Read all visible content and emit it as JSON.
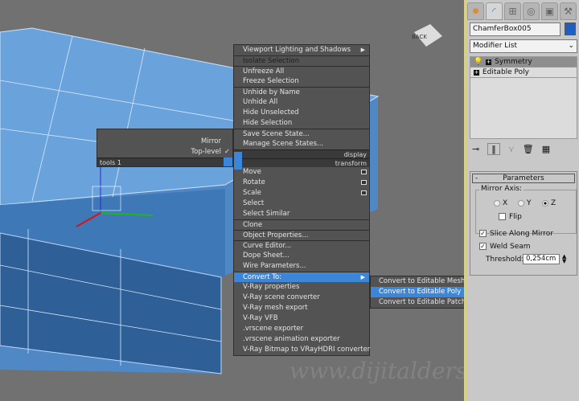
{
  "viewport": {
    "watermark": "www.dijitaldersler.com",
    "viewcube_label": "BACK"
  },
  "left_quad": {
    "items": [
      {
        "label": "Mirror"
      },
      {
        "label": "Top-level",
        "check": "✓"
      }
    ],
    "bar_label": "tools 1"
  },
  "main_quad": {
    "items": [
      {
        "label": "Viewport Lighting and Shadows",
        "arrow": true
      },
      {
        "label": "Isolate Selection",
        "sep": true,
        "dim": true
      },
      {
        "label": "Unfreeze All",
        "sep": true
      },
      {
        "label": "Freeze Selection"
      },
      {
        "label": "Unhide by Name",
        "sep": true
      },
      {
        "label": "Unhide All"
      },
      {
        "label": "Hide Unselected"
      },
      {
        "label": "Hide Selection"
      },
      {
        "label": "Save Scene State...",
        "sep": true
      },
      {
        "label": "Manage Scene States..."
      }
    ],
    "display_label": "display",
    "transform_label": "transform",
    "items2": [
      {
        "label": "Move",
        "box": true
      },
      {
        "label": "Rotate",
        "box": true
      },
      {
        "label": "Scale",
        "box": true
      },
      {
        "label": "Select"
      },
      {
        "label": "Select Similar"
      },
      {
        "label": "Clone",
        "sep": true
      },
      {
        "label": "Object Properties...",
        "sep": true
      },
      {
        "label": "Curve Editor...",
        "sep": true
      },
      {
        "label": "Dope Sheet..."
      },
      {
        "label": "Wire Parameters..."
      },
      {
        "label": "Convert To:",
        "sep": true,
        "arrow": true,
        "hl": true
      },
      {
        "label": "V-Ray properties"
      },
      {
        "label": "V-Ray scene converter"
      },
      {
        "label": "V-Ray mesh export"
      },
      {
        "label": "V-Ray VFB"
      },
      {
        "label": ".vrscene exporter"
      },
      {
        "label": ".vrscene animation exporter"
      },
      {
        "label": "V-Ray Bitmap to VRayHDRI converter"
      }
    ]
  },
  "convert_submenu": {
    "items": [
      {
        "label": "Convert to Editable Mesh"
      },
      {
        "label": "Convert to Editable Poly",
        "hl": true
      },
      {
        "label": "Convert to Editable Patch"
      }
    ]
  },
  "command_panel": {
    "tabs": [
      "create-icon",
      "modify-icon",
      "hierarchy-icon",
      "motion-icon",
      "display-icon",
      "utilities-icon"
    ],
    "object_name": "ChamferBox005",
    "object_color": "#1f5fc0",
    "modifier_list": "Modifier List",
    "stack": [
      {
        "label": "Symmetry",
        "selected": true
      },
      {
        "label": "Editable Poly"
      }
    ],
    "parameters": {
      "title": "Parameters",
      "collapse": "-",
      "mirror_axis_label": "Mirror Axis:",
      "axes": [
        "X",
        "Y",
        "Z"
      ],
      "selected_axis": "Z",
      "flip": "Flip",
      "flip_checked": false,
      "slice": "Slice Along Mirror",
      "slice_checked": true,
      "weld": "Weld Seam",
      "weld_checked": true,
      "threshold_label": "Threshold:",
      "threshold": "0,254cm"
    }
  }
}
